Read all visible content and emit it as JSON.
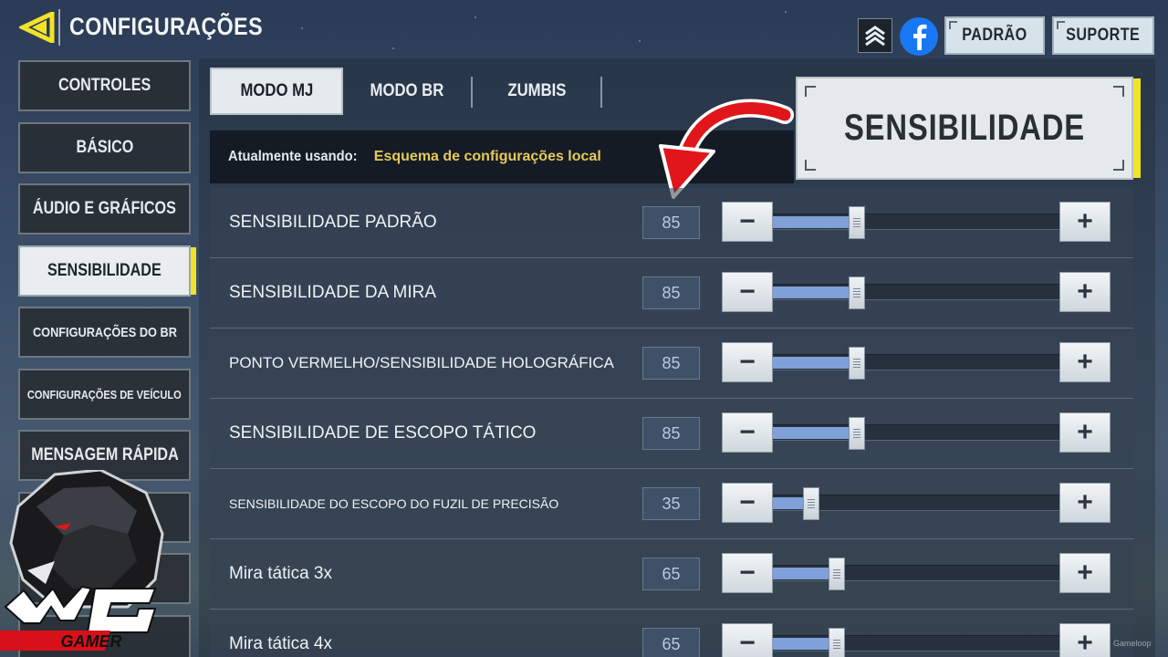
{
  "header": {
    "title": "CONFIGURAÇÕES",
    "buttons": {
      "default": "PADRÃO",
      "support": "SUPORTE"
    }
  },
  "sidebar": {
    "items": [
      {
        "label": "CONTROLES"
      },
      {
        "label": "BÁSICO"
      },
      {
        "label": "ÁUDIO E GRÁFICOS"
      },
      {
        "label": "SENSIBILIDADE",
        "active": true
      },
      {
        "label": "CONFIGURAÇÕES DO BR"
      },
      {
        "label": "CONFIGURAÇÕES DE VEÍCULO"
      },
      {
        "label": "MENSAGEM RÁPIDA"
      }
    ]
  },
  "tabs": [
    {
      "label": "MODO MJ",
      "active": true
    },
    {
      "label": "MODO BR"
    },
    {
      "label": "ZUMBIS"
    }
  ],
  "scheme": {
    "label": "Atualmente usando:",
    "value": "Esquema de configurações local"
  },
  "callout": {
    "title": "SENSIBILIDADE"
  },
  "settings": [
    {
      "label": "SENSIBILIDADE PADRÃO",
      "value": "85",
      "fraction": 0.27
    },
    {
      "label": "SENSIBILIDADE DA MIRA",
      "value": "85",
      "fraction": 0.27
    },
    {
      "label": "PONTO VERMELHO/SENSIBILIDADE HOLOGRÁFICA",
      "value": "85",
      "fraction": 0.27
    },
    {
      "label": "SENSIBILIDADE DE ESCOPO TÁTICO",
      "value": "85",
      "fraction": 0.27
    },
    {
      "label": "SENSIBILIDADE DO ESCOPO DO FUZIL DE PRECISÃO",
      "value": "35",
      "fraction": 0.11
    },
    {
      "label": "Mira tática 3x",
      "value": "65",
      "fraction": 0.2
    },
    {
      "label": "Mira tática 4x",
      "value": "65",
      "fraction": 0.2
    }
  ],
  "controls": {
    "minus": "−",
    "plus": "+"
  },
  "logo": {
    "text": "WG GAMER"
  },
  "watermark": "Gameloop",
  "colors": {
    "accent": "#f2e22a",
    "slider_fill": "#7fa0d8",
    "scheme_value": "#e5c95a",
    "facebook": "#1877f2",
    "arrow": "#e0161b"
  },
  "icons": {
    "back": "chevron-left-icon",
    "rank": "rank-chevrons-icon",
    "social": "facebook-icon"
  }
}
